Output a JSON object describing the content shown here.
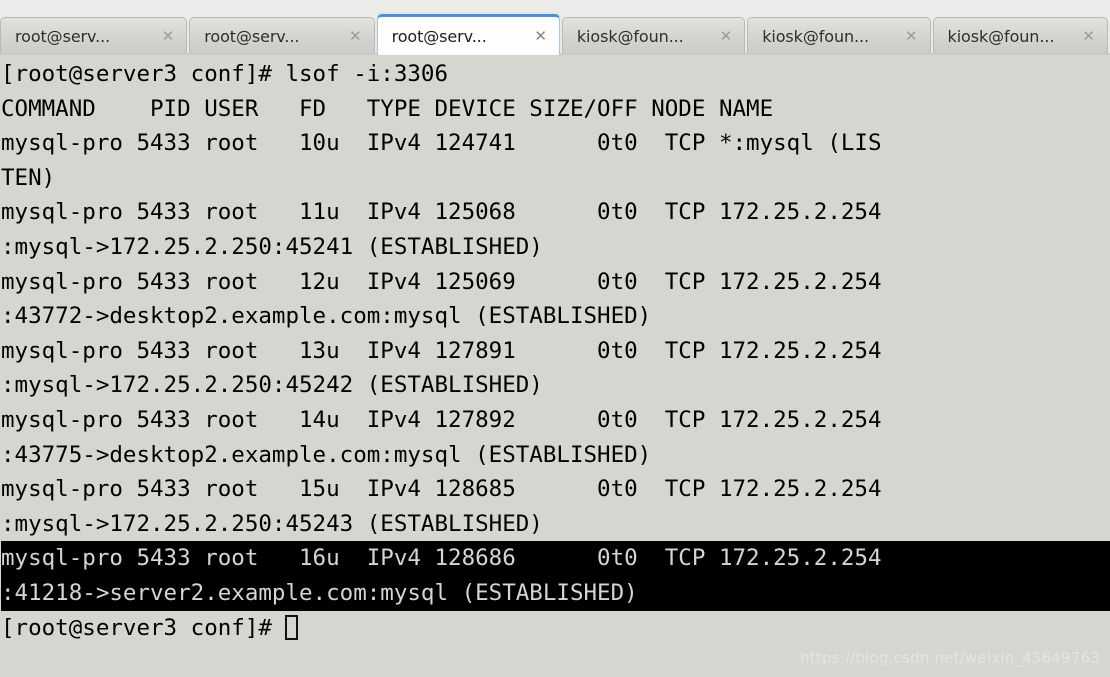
{
  "window": {
    "app": "terminal",
    "background_color": "#d3d7cf",
    "foreground_color": "#000000",
    "tabbar_background": "#ebebe9",
    "active_tab_accent": "#4a90d9"
  },
  "tabbar": {
    "close_glyph": "✕",
    "tabs": [
      {
        "label": "root@serv...",
        "active": false
      },
      {
        "label": "root@serv...",
        "active": false
      },
      {
        "label": "root@serv...",
        "active": true
      },
      {
        "label": "kiosk@foun...",
        "active": false
      },
      {
        "label": "kiosk@foun...",
        "active": false
      },
      {
        "label": "kiosk@foun...",
        "active": false
      }
    ]
  },
  "terminal": {
    "lines": [
      {
        "text": "[root@server3 conf]# lsof -i:3306",
        "selected": false
      },
      {
        "text": "COMMAND    PID USER   FD   TYPE DEVICE SIZE/OFF NODE NAME",
        "selected": false
      },
      {
        "text": "mysql-pro 5433 root   10u  IPv4 124741      0t0  TCP *:mysql (LIS",
        "selected": false
      },
      {
        "text": "TEN)",
        "selected": false
      },
      {
        "text": "mysql-pro 5433 root   11u  IPv4 125068      0t0  TCP 172.25.2.254",
        "selected": false
      },
      {
        "text": ":mysql->172.25.2.250:45241 (ESTABLISHED)",
        "selected": false
      },
      {
        "text": "mysql-pro 5433 root   12u  IPv4 125069      0t0  TCP 172.25.2.254",
        "selected": false
      },
      {
        "text": ":43772->desktop2.example.com:mysql (ESTABLISHED)",
        "selected": false
      },
      {
        "text": "mysql-pro 5433 root   13u  IPv4 127891      0t0  TCP 172.25.2.254",
        "selected": false
      },
      {
        "text": ":mysql->172.25.2.250:45242 (ESTABLISHED)",
        "selected": false
      },
      {
        "text": "mysql-pro 5433 root   14u  IPv4 127892      0t0  TCP 172.25.2.254",
        "selected": false
      },
      {
        "text": ":43775->desktop2.example.com:mysql (ESTABLISHED)",
        "selected": false
      },
      {
        "text": "mysql-pro 5433 root   15u  IPv4 128685      0t0  TCP 172.25.2.254",
        "selected": false
      },
      {
        "text": ":mysql->172.25.2.250:45243 (ESTABLISHED)",
        "selected": false
      },
      {
        "text": "mysql-pro 5433 root   16u  IPv4 128686      0t0  TCP 172.25.2.254",
        "selected": true
      },
      {
        "text": ":41218->server2.example.com:mysql (ESTABLISHED)",
        "selected": true
      }
    ],
    "prompt": "[root@server3 conf]# ",
    "cursor": "block-outline",
    "command_entered": "lsof -i:3306",
    "hostname": "server3",
    "user": "root",
    "cwd": "conf",
    "port": "3306"
  },
  "watermark": {
    "text": "https://blog.csdn.net/weixin_45649763"
  }
}
